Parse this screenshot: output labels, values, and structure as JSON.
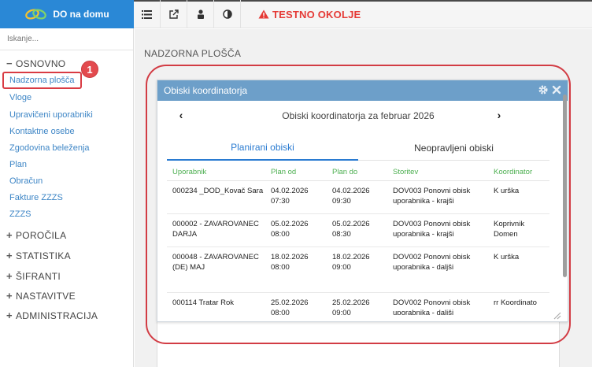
{
  "app": {
    "brand": "DO na domu"
  },
  "toolbar": {
    "environment": "TESTNO OKOLJE"
  },
  "sidebar": {
    "search_placeholder": "Iskanje...",
    "sections": [
      {
        "sign": "−",
        "label": "OSNOVNO"
      },
      {
        "sign": "+",
        "label": "POROČILA"
      },
      {
        "sign": "+",
        "label": "STATISTIKA"
      },
      {
        "sign": "+",
        "label": "ŠIFRANTI"
      },
      {
        "sign": "+",
        "label": "NASTAVITVE"
      },
      {
        "sign": "+",
        "label": "ADMINISTRACIJA"
      }
    ],
    "items": [
      {
        "label": "Nadzorna plošča"
      },
      {
        "label": "Vloge"
      },
      {
        "label": "Upravičeni uporabniki"
      },
      {
        "label": "Kontaktne osebe"
      },
      {
        "label": "Zgodovina beleženja"
      },
      {
        "label": "Plan"
      },
      {
        "label": "Obračun"
      },
      {
        "label": "Fakture ZZZS"
      },
      {
        "label": "ZZZS"
      }
    ],
    "step_badge": "1"
  },
  "main": {
    "page_title": "NADZORNA PLOŠČA",
    "widget": {
      "title": "Obiski koordinatorja",
      "month_title": "Obiski koordinatorja za februar 2026",
      "prev_arrow": "‹",
      "next_arrow": "›",
      "tabs": [
        {
          "label": "Planirani obiski",
          "active": true
        },
        {
          "label": "Neopravljeni obiski",
          "active": false
        }
      ],
      "columns": [
        "Uporabnik",
        "Plan od",
        "Plan do",
        "Storitev",
        "Koordinator"
      ],
      "rows": [
        {
          "user": "000234 _DOD_Kovač Sara",
          "from": "04.02.2026 07:30",
          "to": "04.02.2026 09:30",
          "service": "DOV003 Ponovni obisk uporabnika - krajši",
          "coordinator": "K urška"
        },
        {
          "user": "000002 - ZAVAROVANEC DARJA",
          "from": "05.02.2026 08:00",
          "to": "05.02.2026 08:30",
          "service": "DOV003 Ponovni obisk uporabnika - krajši",
          "coordinator": "Koprivnik Domen"
        },
        {
          "user": "000048 - ZAVAROVANEC (DE) MAJ",
          "from": "18.02.2026 08:00",
          "to": "18.02.2026 09:00",
          "service": "DOV002 Ponovni obisk uporabnika - daljši",
          "coordinator": "K urška"
        },
        {
          "user": "000114 Tratar Rok",
          "from": "25.02.2026 08:00",
          "to": "25.02.2026 09:00",
          "service": "DOV002 Ponovni obisk uporabnika - daljši",
          "coordinator": "rr Koordinato"
        }
      ]
    }
  },
  "icons": {
    "toolbar": [
      "list-icon",
      "external-link-icon",
      "user-lock-icon",
      "contrast-icon",
      "warning-icon"
    ],
    "widget": [
      "gear-icon",
      "close-icon"
    ]
  },
  "colors": {
    "brand": "#2a88d6",
    "link": "#3e86c6",
    "widget_header": "#6d9fc9",
    "active_tab": "#2a7bd1",
    "column_header": "#4caf50",
    "warning": "#e53935",
    "annotation": "#d23c44"
  }
}
